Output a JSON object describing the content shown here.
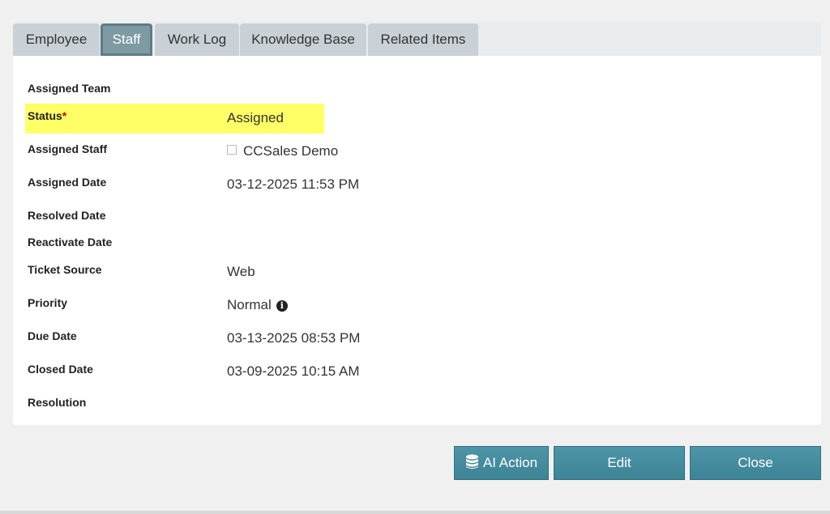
{
  "tabs": [
    {
      "label": "Employee"
    },
    {
      "label": "Staff",
      "active": true
    },
    {
      "label": "Work Log"
    },
    {
      "label": "Knowledge Base"
    },
    {
      "label": "Related Items"
    }
  ],
  "fields": {
    "assigned_team": {
      "label": "Assigned Team",
      "value": ""
    },
    "status": {
      "label": "Status",
      "required_mark": "*",
      "value": "Assigned"
    },
    "assigned_staff": {
      "label": "Assigned Staff",
      "value": "CCSales Demo"
    },
    "assigned_date": {
      "label": "Assigned Date",
      "value": "03-12-2025 11:53 PM"
    },
    "resolved_date": {
      "label": "Resolved Date",
      "value": ""
    },
    "reactivate_date": {
      "label": "Reactivate Date",
      "value": ""
    },
    "ticket_source": {
      "label": "Ticket Source",
      "value": "Web"
    },
    "priority": {
      "label": "Priority",
      "value": "Normal",
      "icon": "info-circle-icon"
    },
    "due_date": {
      "label": "Due Date",
      "value": "03-13-2025 08:53 PM"
    },
    "closed_date": {
      "label": "Closed Date",
      "value": "03-09-2025 10:15 AM"
    },
    "resolution": {
      "label": "Resolution",
      "value": ""
    }
  },
  "buttons": {
    "ai_action": {
      "label": "AI Action",
      "icon": "database-icon"
    },
    "edit": {
      "label": "Edit"
    },
    "close": {
      "label": "Close"
    }
  },
  "colors": {
    "highlight": "#ffff66",
    "button": "#4a8fa2",
    "active_tab": "#7e9aa3",
    "required": "#d00000"
  }
}
